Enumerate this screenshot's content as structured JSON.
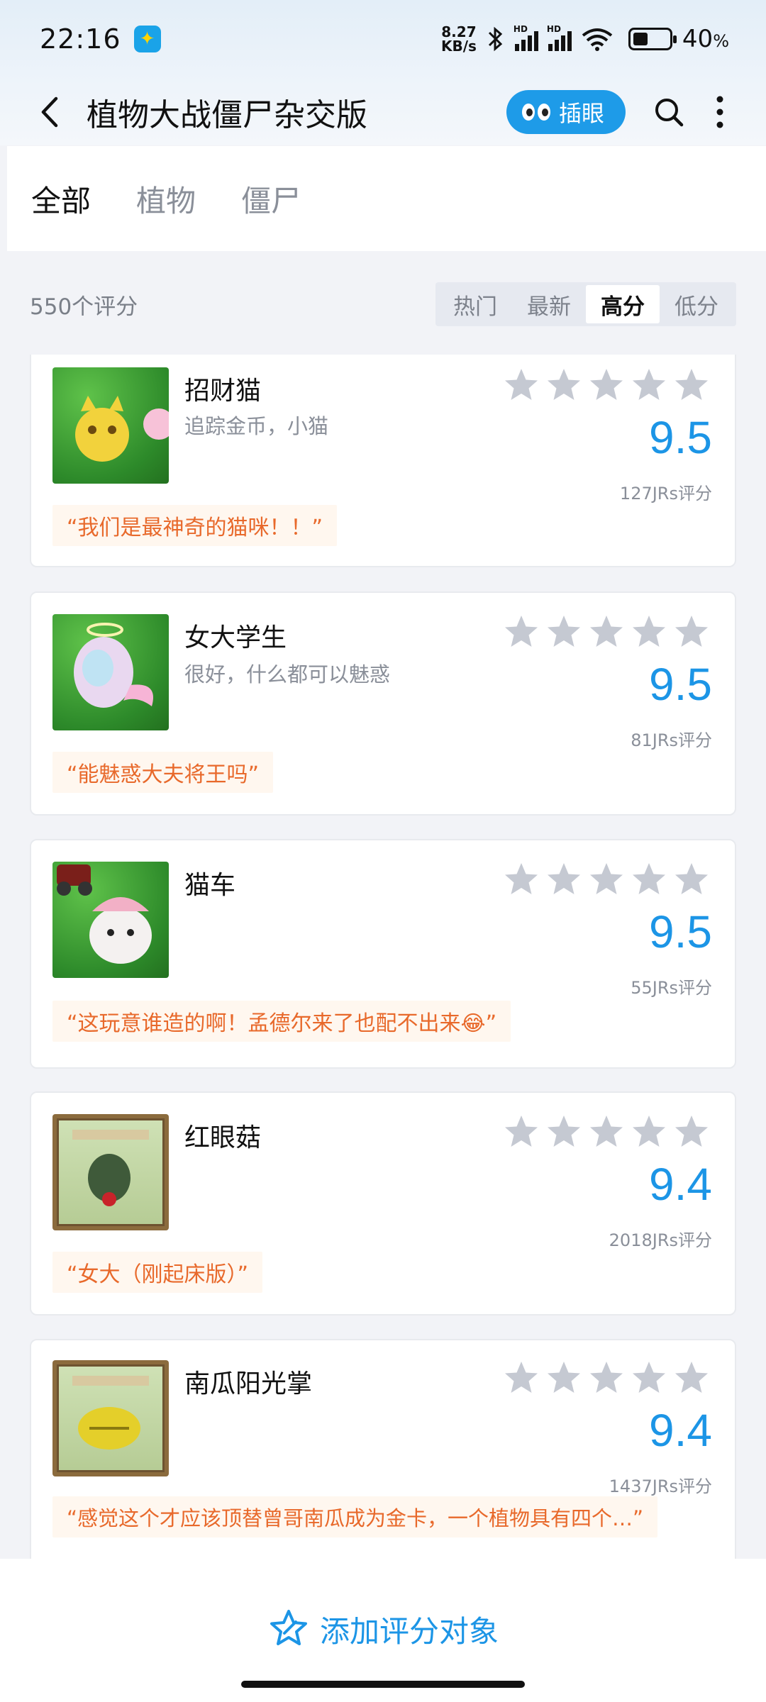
{
  "status": {
    "time": "22:16",
    "netspeed_value": "8.27",
    "netspeed_unit": "KB/s",
    "sim_label": "HD",
    "battery": "40",
    "battery_unit": "%"
  },
  "header": {
    "title": "植物大战僵尸杂交版",
    "peek_label": "插眼"
  },
  "tabs": [
    "全部",
    "植物",
    "僵尸"
  ],
  "filter": {
    "count_label": "550个评分",
    "options": [
      "热门",
      "最新",
      "高分",
      "低分"
    ],
    "selected": "高分"
  },
  "items": [
    {
      "name": "招财猫",
      "desc": "追踪金币，小猫",
      "score": "9.5",
      "raters": "127JRs评分",
      "quote": "“我们是最神奇的猫咪！！”"
    },
    {
      "name": "女大学生",
      "desc": "很好，什么都可以魅惑",
      "score": "9.5",
      "raters": "81JRs评分",
      "quote": "“能魅惑大夫将王吗”"
    },
    {
      "name": "猫车",
      "desc": "",
      "score": "9.5",
      "raters": "55JRs评分",
      "quote": "“这玩意谁造的啊！孟德尔来了也配不出来😂”"
    },
    {
      "name": "红眼菇",
      "desc": "",
      "score": "9.4",
      "raters": "2018JRs评分",
      "quote": "“女大（刚起床版）”"
    },
    {
      "name": "南瓜阳光掌",
      "desc": "",
      "score": "9.4",
      "raters": "1437JRs评分",
      "quote": "“感觉这个才应该顶替曾哥南瓜成为金卡，一个植物具有四个…”"
    }
  ],
  "bottom": {
    "add_label": "添加评分对象"
  },
  "colors": {
    "accent": "#1c95e6",
    "quote": "#e8692b",
    "star_empty": "#c5c9d2"
  }
}
